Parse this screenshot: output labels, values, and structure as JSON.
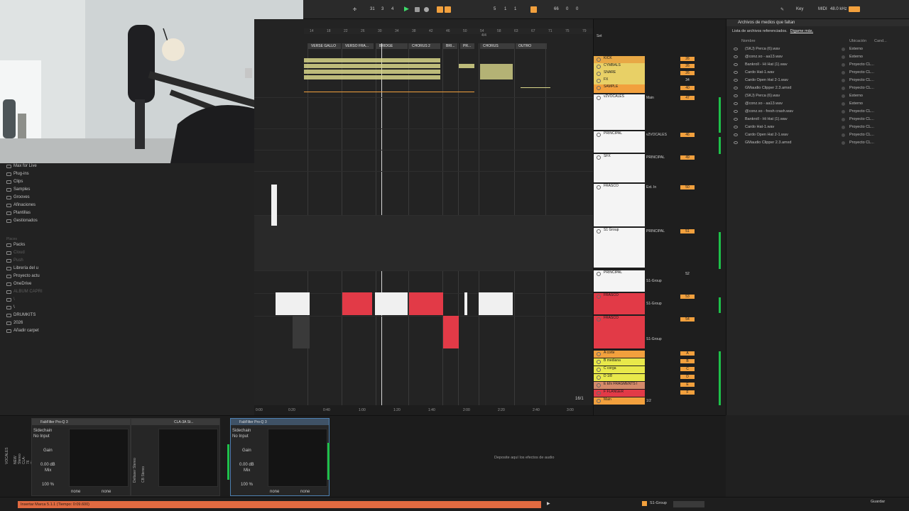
{
  "transport": {
    "bar": "31",
    "beat": "3",
    "sixteenth": "4",
    "loop_start_bar": "5",
    "loop_start_beat": "1",
    "loop_start_sixteenth": "1",
    "loop_len_bar": "66",
    "loop_len_beat": "0",
    "loop_len_sixteenth": "0",
    "key_label": "Key",
    "midi_label": "MIDI",
    "sample_rate": "48.0 kHz",
    "accent_color": "#f2a03d"
  },
  "browser": {
    "categories": [
      {
        "label": "Max for Live",
        "icon": "max-icon"
      },
      {
        "label": "Plug-ins",
        "icon": "plugin-icon"
      },
      {
        "label": "Clips",
        "icon": "clip-icon"
      },
      {
        "label": "Samples",
        "icon": "sample-icon"
      },
      {
        "label": "Grooves",
        "icon": "groove-icon"
      },
      {
        "label": "Afinaciones",
        "icon": "tuning-icon"
      },
      {
        "label": "Plantillas",
        "icon": "template-icon"
      },
      {
        "label": "Gestionados",
        "icon": "managed-icon"
      }
    ],
    "places_header": "Places",
    "places": [
      {
        "label": "Packs",
        "icon": "folder-icon"
      },
      {
        "label": "Cloud",
        "icon": "cloud-icon"
      },
      {
        "label": "Push",
        "icon": "push-icon"
      },
      {
        "label": "Librería del u",
        "icon": "folder-icon"
      },
      {
        "label": "Proyecto actu",
        "icon": "folder-icon"
      },
      {
        "label": "OneDrive",
        "icon": "folder-icon"
      },
      {
        "label": "ALBUM CAPRI",
        "icon": "folder-icon"
      },
      {
        "label": "\\",
        "icon": "folder-icon"
      },
      {
        "label": "\\",
        "icon": "folder-icon"
      },
      {
        "label": "DRUMKITS",
        "icon": "folder-icon"
      },
      {
        "label": "2026",
        "icon": "folder-icon"
      },
      {
        "label": "Añadir carpet",
        "icon": "add-folder-icon"
      }
    ]
  },
  "arrangement": {
    "ruler": [
      "14",
      "18",
      "22",
      "26",
      "30",
      "34",
      "38",
      "42",
      "46",
      "50",
      "54",
      "58",
      "63",
      "67",
      "71",
      "75",
      "79"
    ],
    "signature": "4/4",
    "markers": [
      "VERSE GALLO",
      "VERSO FRA...",
      "BRIDGE",
      "CHORUS 2",
      "BRI...",
      "PR...",
      "CHORUS",
      "OUTRO"
    ],
    "timeline": [
      "0:00",
      "0:20",
      "0:40",
      "1:00",
      "1:20",
      "1:40",
      "2:00",
      "2:20",
      "2:40",
      "3:00"
    ],
    "zoom_label": "16/1",
    "colors": {
      "clip_yellow": "#d8d68a",
      "clip_red": "#e23a47",
      "marker_orange": "#f2a03d"
    }
  },
  "mixer": {
    "set_label": "Set",
    "tracks": [
      {
        "name": "KICK",
        "color": "#e8a845",
        "route": "",
        "vol": "26"
      },
      {
        "name": "CYMBALS",
        "color": "#e8d066",
        "route": "",
        "vol": "26"
      },
      {
        "name": "SNARE",
        "color": "#e8d066",
        "route": "",
        "vol": "26"
      },
      {
        "name": "FX",
        "color": "#e8d066",
        "route": "",
        "vol": "34"
      },
      {
        "name": "SAMPLE",
        "color": "#f2a03d",
        "route": "",
        "vol": "40"
      },
      {
        "name": "v2VOCALES",
        "color": "#f4f4f4",
        "route": "Main",
        "vol": "47"
      },
      {
        "name": "PRINCIPAL",
        "color": "#f4f4f4",
        "route": "v2VOCALES",
        "vol": "46"
      },
      {
        "name": "SFX",
        "color": "#f4f4f4",
        "route": "PRINCIPAL",
        "vol": "49"
      },
      {
        "name": "FRASCO",
        "color": "#f4f4f4",
        "route": "Ext. In",
        "vol": "50"
      },
      {
        "name": "S1 Group",
        "color": "#f4f4f4",
        "route": "PRINCIPAL",
        "vol": "51"
      },
      {
        "name": "PRINCIPAL",
        "color": "#f4f4f4",
        "route": "S1-Group",
        "vol": "52"
      },
      {
        "name": "FRASCO",
        "color": "#e23a47",
        "route": "S1-Group",
        "vol": "53"
      },
      {
        "name": "FRASCO",
        "color": "#e23a47",
        "route": "S1-Group",
        "vol": "54"
      }
    ],
    "returns": [
      {
        "name": "A corte",
        "letter": "A",
        "color": "#f2a03d"
      },
      {
        "name": "B mediana",
        "letter": "B",
        "color": "#e8e84a"
      },
      {
        "name": "C corga",
        "letter": "C",
        "color": "#e8e84a"
      },
      {
        "name": "D 1/8",
        "letter": "D",
        "color": "#e8e84a"
      },
      {
        "name": "E Efx FRAGMENTS I",
        "letter": "E",
        "color": "#d58a6a"
      },
      {
        "name": "F FLANGER",
        "letter": "F",
        "color": "#e23a47"
      },
      {
        "name": "Main",
        "letter": "",
        "color": "#f2a03d"
      }
    ],
    "main_route": "1/2",
    "meter_color": "#1ec04a"
  },
  "missing_files": {
    "title": "Archivos de medios que faltan",
    "subtitle": "Lista de archivos referenciados.",
    "link": "Digame más.",
    "columns": {
      "name": "Nombre",
      "location": "Ubicación",
      "count": "Cand..."
    },
    "rows": [
      {
        "name": "(SKJ) Perca (6).wav",
        "location": "Externo"
      },
      {
        "name": "@conz.xo - aa13.wav",
        "location": "Externo"
      },
      {
        "name": "Bankroll - Hi Hat (1).wav",
        "location": "Proyecto CL..."
      },
      {
        "name": "Cardo Hat-1.wav",
        "location": "Proyecto CL..."
      },
      {
        "name": "Cardo Open Hat 2-1.wav",
        "location": "Proyecto CL..."
      },
      {
        "name": "GMaudio Clipper 2.3.amxd",
        "location": "Proyecto CL..."
      },
      {
        "name": "(SKJ) Perca (6).wav",
        "location": "Externo"
      },
      {
        "name": "@conz.xo - aa13.wav",
        "location": "Externo"
      },
      {
        "name": "@conz.xo - fresh crash.wav",
        "location": "Proyecto CL..."
      },
      {
        "name": "Bankroll - Hi Hat (1).wav",
        "location": "Proyecto CL..."
      },
      {
        "name": "Cardo Hat-1.wav",
        "location": "Proyecto CL..."
      },
      {
        "name": "Cardo Open Hat 2-1.wav",
        "location": "Proyecto CL..."
      },
      {
        "name": "GMaudio Clipper 2.3.amxd",
        "location": "Proyecto CL..."
      }
    ]
  },
  "devices": {
    "chain": [
      {
        "title": "FabFilter Pro-Q 3",
        "sidechain": "Sidechain",
        "input": "No Input",
        "gain_label": "Gain",
        "gain": "0.00 dB",
        "mix_label": "Mix",
        "mix": "100 %",
        "none1": "none",
        "none2": "none"
      },
      {
        "title": "CLA-3A St...",
        "side1": "Deltaser Stereo",
        "side2": "CB Stereo"
      },
      {
        "title": "FabFilter Pro-Q 3",
        "sidechain": "Sidechain",
        "input": "No Input",
        "gain_label": "Gain",
        "gain": "0.00 dB",
        "mix_label": "Mix",
        "mix": "100 %",
        "none1": "none",
        "none2": "none"
      }
    ],
    "rack_labels": [
      "VOCALES",
      "NEW Stereo",
      "CLA-76 Stereo"
    ],
    "drop_hint": "Deposite aquí los efectos de audio"
  },
  "status": {
    "message": "Insertar Marca 5.1.1 (Tiempo: 0:09.600)",
    "group": "S1-Group",
    "save": "Guardar",
    "message_color": "#e06a41"
  }
}
